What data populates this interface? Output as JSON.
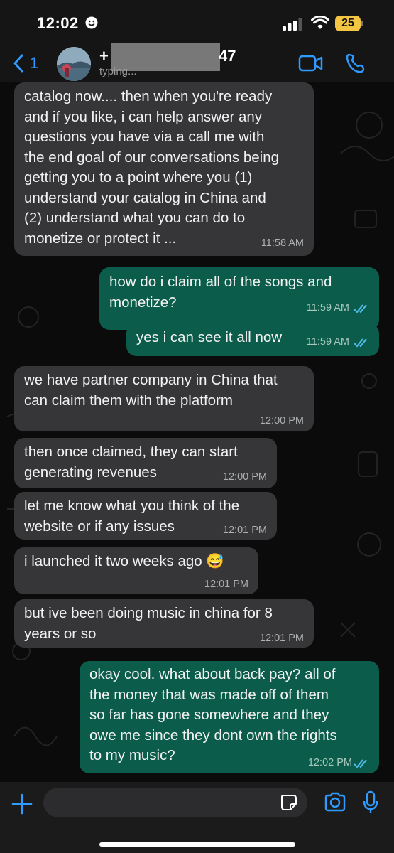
{
  "status_bar": {
    "time": "12:02",
    "battery_level": "25",
    "icons": [
      "smiley-face-icon",
      "cell-signal-icon",
      "wifi-icon",
      "battery-icon"
    ],
    "battery_color": "#f4c542"
  },
  "header": {
    "back_count": "1",
    "contact_prefix": "+",
    "contact_suffix": "47",
    "status": "typing...",
    "icons": [
      "chevron-left-icon",
      "video-call-icon",
      "phone-call-icon"
    ],
    "accent": "#2f9bff"
  },
  "messages": [
    {
      "direction": "incoming",
      "text": "catalog now.... then when you're ready\nand if you like,  i can help answer any\nquestions you have via a call  me with\nthe end goal of our conversations being\ngetting you to a point where you (1)\nunderstand your catalog in China and\n(2) understand what you can do to\nmonetize or protect it ...",
      "time": "11:58 AM"
    },
    {
      "direction": "outgoing",
      "text": "how do i claim all of the songs and\nmonetize?",
      "time": "11:59 AM",
      "read": true
    },
    {
      "direction": "outgoing",
      "text": "yes i can see it all now",
      "time": "11:59 AM",
      "read": true
    },
    {
      "direction": "incoming",
      "text": "we have partner company in China that\ncan claim them with the platform",
      "time": "12:00 PM"
    },
    {
      "direction": "incoming",
      "text": "then once claimed, they can start\ngenerating revenues",
      "time": "12:00 PM"
    },
    {
      "direction": "incoming",
      "text": "let me know what you think of the\nwebsite or if any issues",
      "time": "12:01 PM"
    },
    {
      "direction": "incoming",
      "text": "i launched it two weeks ago 😅",
      "time": "12:01 PM"
    },
    {
      "direction": "incoming",
      "text": "but ive been doing music in china for 8\nyears or so",
      "time": "12:01 PM"
    },
    {
      "direction": "outgoing",
      "text": "okay cool. what about back pay? all of\nthe money that was made off of them\nso far has gone somewhere and they\nowe me since they dont own the rights\nto my music?",
      "time": "12:02 PM",
      "read": true
    }
  ],
  "input_bar": {
    "placeholder": "",
    "icons": [
      "plus-icon",
      "sticker-icon",
      "camera-icon",
      "microphone-icon"
    ]
  },
  "colors": {
    "incoming_bubble": "#363638",
    "outgoing_bubble": "#0b5c4a",
    "read_ticks": "#53bdeb",
    "background": "#0b0b0b"
  }
}
